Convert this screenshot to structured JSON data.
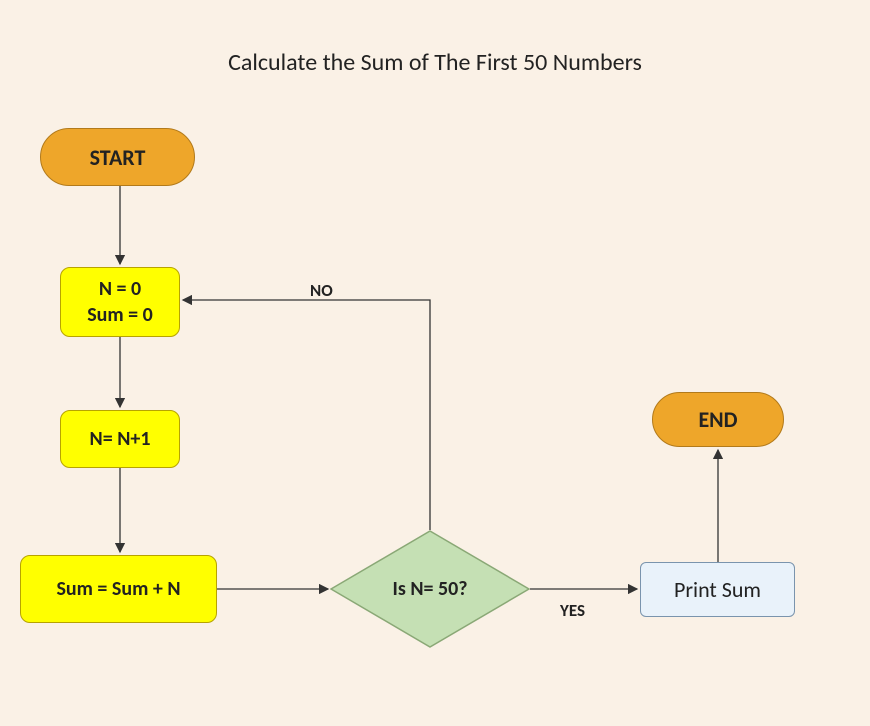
{
  "title": "Calculate the Sum of The First 50 Numbers",
  "nodes": {
    "start": "START",
    "init_line1": "N = 0",
    "init_line2": "Sum = 0",
    "inc": "N= N+1",
    "sum": "Sum = Sum + N",
    "decision": "Is N= 50?",
    "print": "Print Sum",
    "end": "END"
  },
  "labels": {
    "no": "NO",
    "yes": "YES"
  }
}
